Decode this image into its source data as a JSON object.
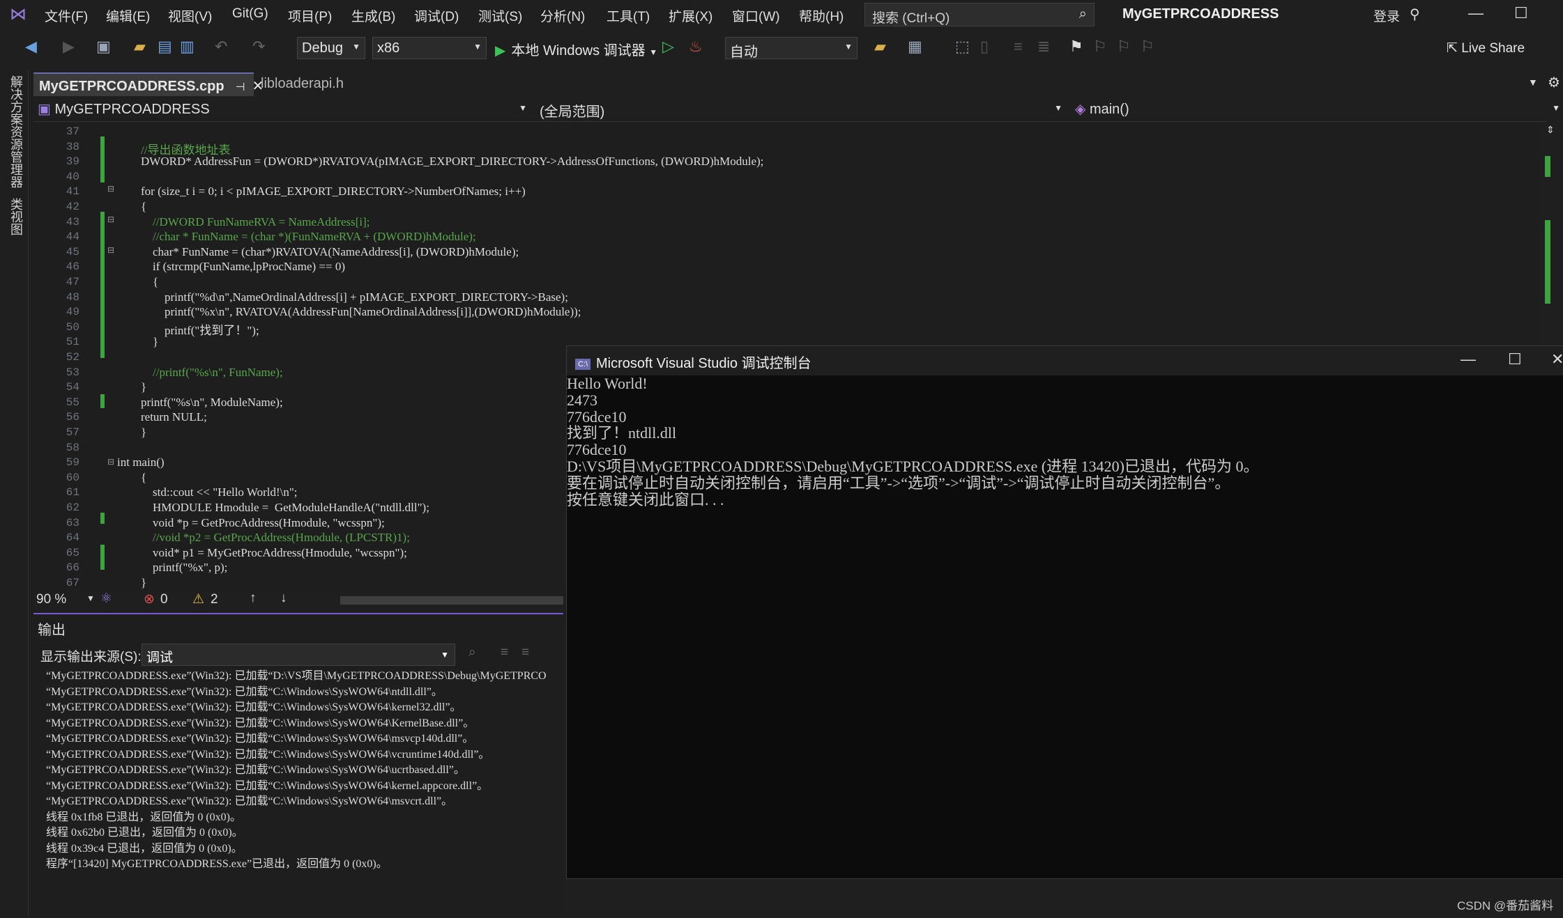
{
  "menu": [
    "文件(F)",
    "编辑(E)",
    "视图(V)",
    "Git(G)",
    "项目(P)",
    "生成(B)",
    "调试(D)",
    "测试(S)",
    "分析(N)",
    "工具(T)",
    "扩展(X)",
    "窗口(W)",
    "帮助(H)"
  ],
  "search_placeholder": "搜索 (Ctrl+Q)",
  "window_title": "MyGETPRCOADDRESS",
  "login": "登录",
  "toolbar": {
    "config": "Debug",
    "platform": "x86",
    "run_label": "本地 Windows 调试器",
    "auto": "自动",
    "live_share": "Live Share"
  },
  "side_tabs": [
    "解决方案资源管理器",
    "类视图"
  ],
  "tabs": [
    "MyGETPRCOADDRESS.cpp",
    "libloaderapi.h"
  ],
  "nav": {
    "project": "MyGETPRCOADDRESS",
    "scope": "(全局范围)",
    "member": "main()"
  },
  "code_lines": [
    {
      "n": "37",
      "t": ""
    },
    {
      "n": "38",
      "t": "//导出函数地址表"
    },
    {
      "n": "39",
      "t": "DWORD* AddressFun = (DWORD*)RVATOVA(pIMAGE_EXPORT_DIRECTORY->AddressOfFunctions, (DWORD)hModule);"
    },
    {
      "n": "40",
      "t": ""
    },
    {
      "n": "41",
      "t": "for (size_t i = 0; i < pIMAGE_EXPORT_DIRECTORY->NumberOfNames; i++)"
    },
    {
      "n": "42",
      "t": "{"
    },
    {
      "n": "43",
      "t": "    //DWORD FunNameRVA = NameAddress[i];"
    },
    {
      "n": "44",
      "t": "    //char * FunName = (char *)(FunNameRVA + (DWORD)hModule);"
    },
    {
      "n": "45",
      "t": "    char* FunName = (char*)RVATOVA(NameAddress[i], (DWORD)hModule);"
    },
    {
      "n": "46",
      "t": "    if (strcmp(FunName,lpProcName) == 0)"
    },
    {
      "n": "47",
      "t": "    {"
    },
    {
      "n": "48",
      "t": "        printf(\"%d\\n\",NameOrdinalAddress[i] + pIMAGE_EXPORT_DIRECTORY->Base);"
    },
    {
      "n": "49",
      "t": "        printf(\"%x\\n\", RVATOVA(AddressFun[NameOrdinalAddress[i]],(DWORD)hModule));"
    },
    {
      "n": "50",
      "t": "        printf(\"找到了！\");"
    },
    {
      "n": "51",
      "t": "    }"
    },
    {
      "n": "52",
      "t": ""
    },
    {
      "n": "53",
      "t": "    //printf(\"%s\\n\", FunName);"
    },
    {
      "n": "54",
      "t": "}"
    },
    {
      "n": "55",
      "t": "printf(\"%s\\n\", ModuleName);"
    },
    {
      "n": "56",
      "t": "return NULL;"
    },
    {
      "n": "57",
      "t": "}"
    },
    {
      "n": "58",
      "t": ""
    },
    {
      "n": "59",
      "t": "int main()"
    },
    {
      "n": "60",
      "t": "{"
    },
    {
      "n": "61",
      "t": "    std::cout << \"Hello World!\\n\";"
    },
    {
      "n": "62",
      "t": "    HMODULE Hmodule =  GetModuleHandleA(\"ntdll.dll\");"
    },
    {
      "n": "63",
      "t": "    void *p = GetProcAddress(Hmodule, \"wcsspn\");"
    },
    {
      "n": "64",
      "t": "    //void *p2 = GetProcAddress(Hmodule, (LPCSTR)1);"
    },
    {
      "n": "65",
      "t": "    void* p1 = MyGetProcAddress(Hmodule, \"wcsspn\");"
    },
    {
      "n": "66",
      "t": "    printf(\"%x\", p);"
    },
    {
      "n": "67",
      "t": "}"
    }
  ],
  "status": {
    "zoom": "90 %",
    "errors": "0",
    "warnings": "2"
  },
  "output": {
    "header": "输出",
    "source_label": "显示输出来源(S):",
    "source_value": "调试",
    "lines": [
      "“MyGETPRCOADDRESS.exe”(Win32): 已加载“D:\\VS项目\\MyGETPRCOADDRESS\\Debug\\MyGETPRCO",
      "“MyGETPRCOADDRESS.exe”(Win32): 已加载“C:\\Windows\\SysWOW64\\ntdll.dll”。",
      "“MyGETPRCOADDRESS.exe”(Win32): 已加载“C:\\Windows\\SysWOW64\\kernel32.dll”。",
      "“MyGETPRCOADDRESS.exe”(Win32): 已加载“C:\\Windows\\SysWOW64\\KernelBase.dll”。",
      "“MyGETPRCOADDRESS.exe”(Win32): 已加载“C:\\Windows\\SysWOW64\\msvcp140d.dll”。",
      "“MyGETPRCOADDRESS.exe”(Win32): 已加载“C:\\Windows\\SysWOW64\\vcruntime140d.dll”。",
      "“MyGETPRCOADDRESS.exe”(Win32): 已加载“C:\\Windows\\SysWOW64\\ucrtbased.dll”。",
      "“MyGETPRCOADDRESS.exe”(Win32): 已加载“C:\\Windows\\SysWOW64\\kernel.appcore.dll”。",
      "“MyGETPRCOADDRESS.exe”(Win32): 已加载“C:\\Windows\\SysWOW64\\msvcrt.dll”。",
      "线程 0x1fb8 已退出，返回值为 0 (0x0)。",
      "线程 0x62b0 已退出，返回值为 0 (0x0)。",
      "线程 0x39c4 已退出，返回值为 0 (0x0)。",
      "程序“[13420] MyGETPRCOADDRESS.exe”已退出，返回值为 0 (0x0)。"
    ]
  },
  "console": {
    "title": "Microsoft Visual Studio 调试控制台",
    "lines": [
      "Hello World!",
      "2473",
      "776dce10",
      "找到了！ntdll.dll",
      "776dce10",
      "D:\\VS项目\\MyGETPRCOADDRESS\\Debug\\MyGETPRCOADDRESS.exe (进程 13420)已退出，代码为 0。",
      "要在调试停止时自动关闭控制台，请启用“工具”->“选项”->“调试”->“调试停止时自动关闭控制台”。",
      "按任意键关闭此窗口. . ."
    ]
  },
  "credit": "CSDN @番茄酱料"
}
